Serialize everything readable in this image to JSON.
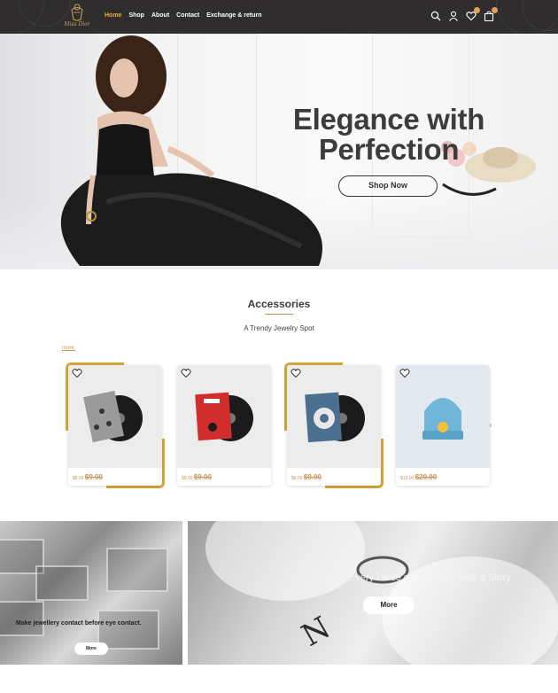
{
  "header": {
    "logo_icon": "jewelry-logo-icon",
    "logo_text": "Miss Dior",
    "nav": [
      {
        "label": "Home",
        "active": true
      },
      {
        "label": "Shop",
        "active": false
      },
      {
        "label": "About",
        "active": false
      },
      {
        "label": "Contact",
        "active": false
      },
      {
        "label": "Exchange & return",
        "active": false
      }
    ],
    "icons": [
      "search-icon",
      "user-icon",
      "heart-icon",
      "bag-icon"
    ],
    "accent_color": "#e8b030",
    "background": "#2f2d2e"
  },
  "hero": {
    "title_line1": "Elegance with",
    "title_line2": "Perfection",
    "button_label": "Shop Now"
  },
  "accessories": {
    "title": "Accessories",
    "subtitle": "A Trendy Jewelry Spot",
    "more_label": "more.",
    "products": [
      {
        "price": "$8.00",
        "old_price": "$9.00",
        "image": "vinyl-record-gray-icon"
      },
      {
        "price": "$9.00",
        "old_price": "$9.00",
        "image": "vinyl-record-red-icon"
      },
      {
        "price": "$8.00",
        "old_price": "$9.00",
        "image": "vinyl-record-blue-icon"
      },
      {
        "price": "$19.00",
        "old_price": "$20.00",
        "image": "beanie-hat-icon"
      }
    ],
    "price_color": "#c8955a",
    "highlight_color": "#d8a93a"
  },
  "banners": {
    "left_text": "Make jewellery contact before eye contact.",
    "left_button": "More",
    "right_text": "Every Piece of Jewellery Tells a Story",
    "right_button": "More"
  }
}
